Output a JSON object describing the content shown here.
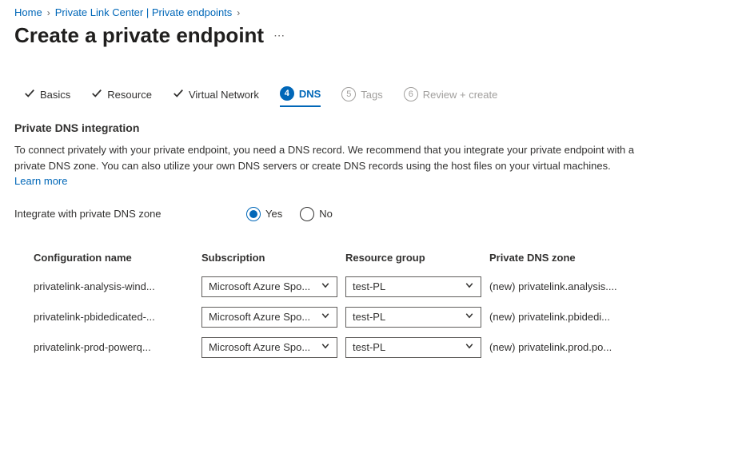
{
  "breadcrumb": {
    "home": "Home",
    "center": "Private Link Center | Private endpoints"
  },
  "title": "Create a private endpoint",
  "tabs": {
    "basics": "Basics",
    "resource": "Resource",
    "vnet": "Virtual Network",
    "dns_num": "4",
    "dns": "DNS",
    "tags_num": "5",
    "tags": "Tags",
    "review_num": "6",
    "review": "Review + create"
  },
  "section_title": "Private DNS integration",
  "desc_text": "To connect privately with your private endpoint, you need a DNS record. We recommend that you integrate your private endpoint with a private DNS zone. You can also utilize your own DNS servers or create DNS records using the host files on your virtual machines.",
  "learn_more": "Learn more",
  "field_label": "Integrate with private DNS zone",
  "yes": "Yes",
  "no": "No",
  "headers": {
    "config": "Configuration name",
    "sub": "Subscription",
    "rg": "Resource group",
    "zone": "Private DNS zone"
  },
  "rows": [
    {
      "config": "privatelink-analysis-wind...",
      "sub": "Microsoft Azure Spo...",
      "rg": "test-PL",
      "zone": "(new) privatelink.analysis...."
    },
    {
      "config": "privatelink-pbidedicated-...",
      "sub": "Microsoft Azure Spo...",
      "rg": "test-PL",
      "zone": "(new) privatelink.pbidedi..."
    },
    {
      "config": "privatelink-prod-powerq...",
      "sub": "Microsoft Azure Spo...",
      "rg": "test-PL",
      "zone": "(new) privatelink.prod.po..."
    }
  ]
}
